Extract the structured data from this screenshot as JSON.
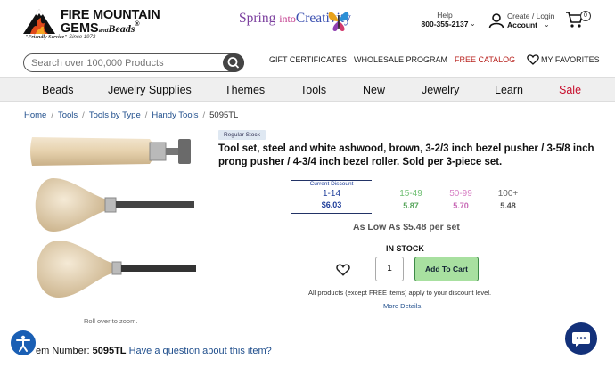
{
  "header": {
    "logo_line1": "FIRE MOUNTAIN",
    "logo_line2": "GEMS",
    "logo_and": "and",
    "logo_beads": "Beads",
    "logo_reg": "®",
    "logo_tagline": "\"Friendly Service\"",
    "logo_since": "Since 1973",
    "promo_spring": "Spring",
    "promo_into": "into",
    "promo_creativity": "Creativity",
    "help_label": "Help",
    "help_phone": "800-355-2137",
    "account_label": "Create / Login",
    "account_sub": "Account",
    "cart_count": "0"
  },
  "search": {
    "placeholder": "Search over 100,000 Products"
  },
  "top_links": {
    "gift": "GIFT CERTIFICATES",
    "wholesale": "WHOLESALE PROGRAM",
    "catalog": "FREE CATALOG",
    "favorites": "MY FAVORITES"
  },
  "nav": [
    "Beads",
    "Jewelry Supplies",
    "Themes",
    "Tools",
    "New",
    "Jewelry",
    "Learn",
    "Sale"
  ],
  "breadcrumb": [
    "Home",
    "Tools",
    "Tools by Type",
    "Handy Tools",
    "5095TL"
  ],
  "product": {
    "badge": "Regular Stock",
    "title": "Tool set, steel and white ashwood, brown, 3-2/3 inch bezel pusher / 3-5/8 inch prong pusher / 4-3/4 inch bezel roller. Sold per 3-piece set.",
    "current_discount": "Current Discount",
    "tiers": [
      {
        "qty": "1-14",
        "price": "$6.03"
      },
      {
        "qty": "15-49",
        "price": "5.87"
      },
      {
        "qty": "50-99",
        "price": "5.70"
      },
      {
        "qty": "100+",
        "price": "5.48"
      }
    ],
    "as_low_as": "As Low As $5.48 per set",
    "stock": "IN STOCK",
    "quantity": "1",
    "add_to_cart": "Add To Cart",
    "discount_note": "All products (except FREE items) apply to your discount level.",
    "more_details": "More Details.",
    "zoom_hint": "Roll over to zoom.",
    "item_number_label": "em Number:",
    "item_number": "5095TL",
    "question_link": "Have a question about this item?"
  },
  "colors": {
    "accent_blue": "#1f3e9a",
    "tier_green": "#6fbf73",
    "tier_pink": "#d77fc4",
    "sale_red": "#c8102e",
    "add_cart_green": "#a8e0a0",
    "chat_navy": "#13317a"
  },
  "icons": [
    "mountain-logo-icon",
    "butterfly-icon",
    "chevron-down-icon",
    "user-icon",
    "cart-icon",
    "search-icon",
    "heart-icon",
    "accessibility-icon",
    "chat-icon"
  ]
}
